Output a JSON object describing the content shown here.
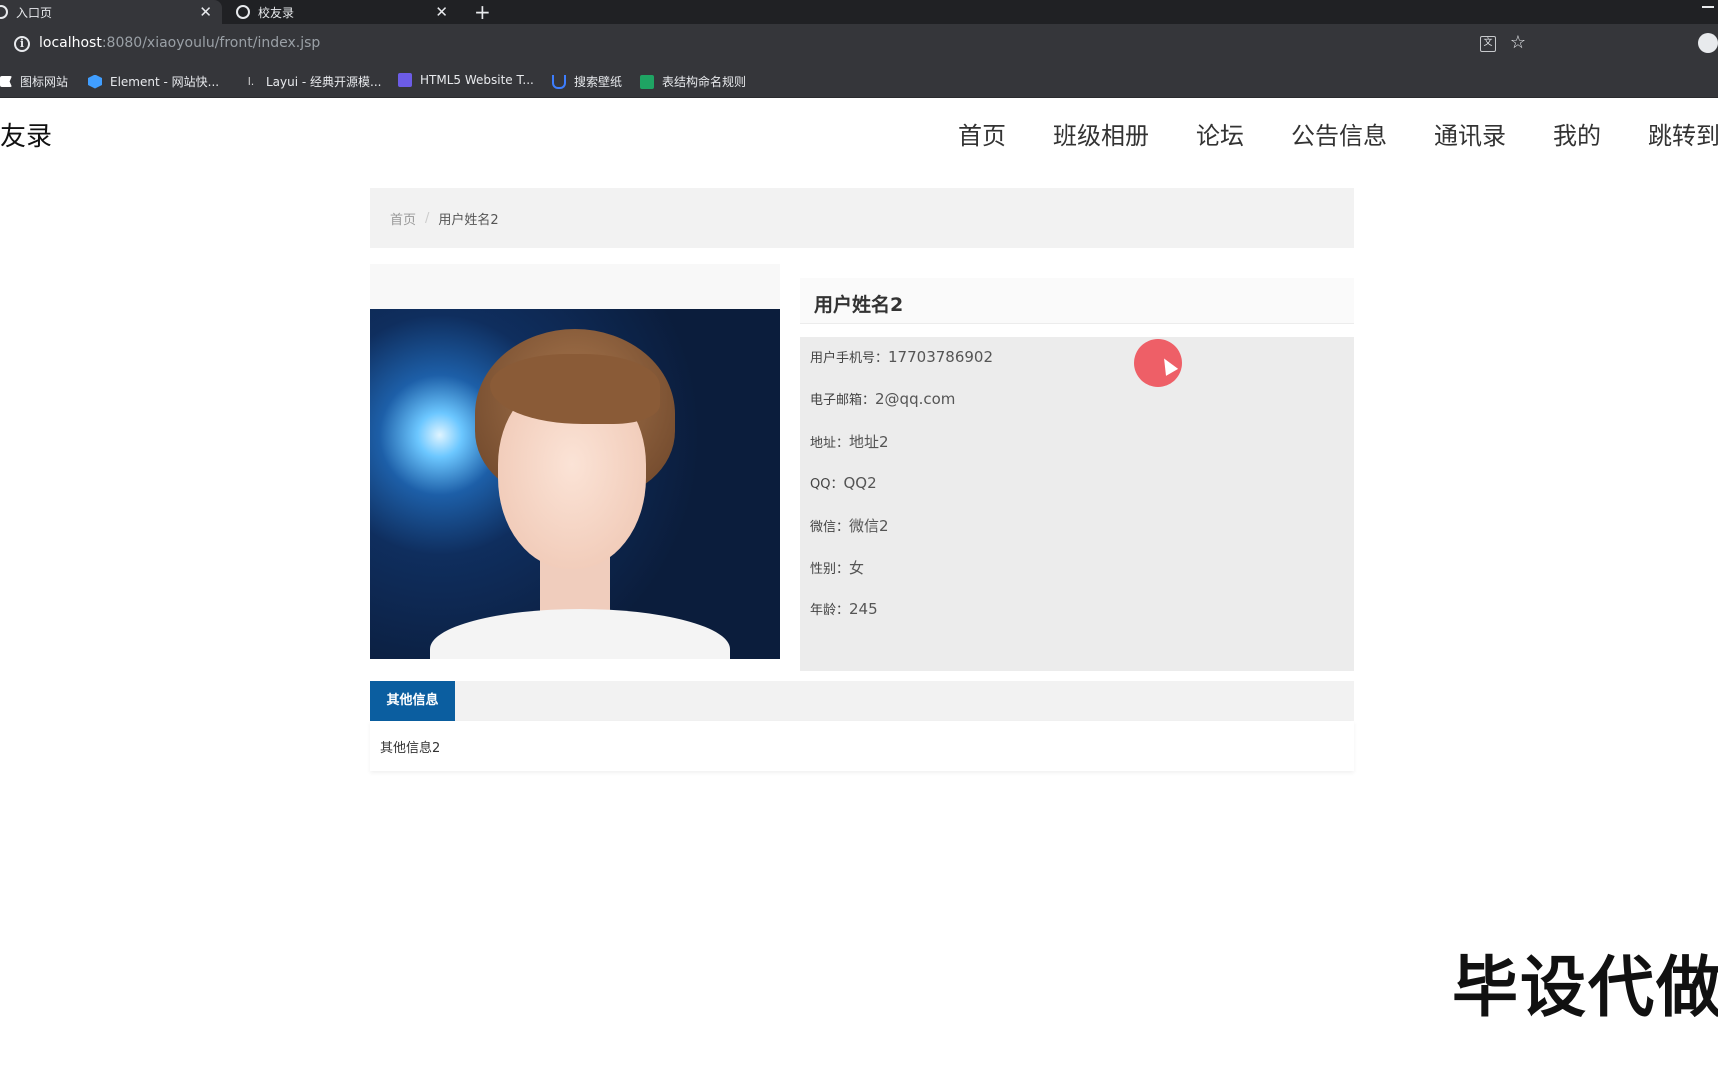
{
  "browser": {
    "tabs": [
      {
        "title": "入口页",
        "active": true
      },
      {
        "title": "校友录",
        "active": false
      }
    ],
    "new_tab": "+",
    "close_glyph": "✕",
    "url_host": "localhost",
    "url_path": ":8080/xiaoyoulu/front/index.jsp",
    "bookmarks": [
      {
        "label": "图标网站",
        "icon": "flag-icon",
        "color": "#ffffff"
      },
      {
        "label": "Element - 网站快...",
        "icon": "element-icon",
        "color": "#409eff"
      },
      {
        "label": "Layui - 经典开源模...",
        "icon": "layui-icon",
        "color": "#d7d7d7"
      },
      {
        "label": "HTML5 Website T...",
        "icon": "html5-icon",
        "color": "#6c5ce7"
      },
      {
        "label": "搜索壁纸",
        "icon": "wallpaper-icon",
        "color": "#3d7eff"
      },
      {
        "label": "表结构命名规则",
        "icon": "sheet-icon",
        "color": "#1fa463"
      }
    ]
  },
  "site": {
    "logo": "校友录",
    "nav": [
      "首页",
      "班级相册",
      "论坛",
      "公告信息",
      "通讯录",
      "我的",
      "跳转到后台"
    ]
  },
  "breadcrumb": {
    "home": "首页",
    "separator": "/",
    "current": "用户姓名2"
  },
  "detail": {
    "title": "用户姓名2",
    "fields": [
      {
        "label": "用户手机号：",
        "value": "17703786902"
      },
      {
        "label": "电子邮箱：",
        "value": "2@qq.com"
      },
      {
        "label": "地址：",
        "value": "地址2"
      },
      {
        "label": "QQ：",
        "value": "QQ2"
      },
      {
        "label": "微信：",
        "value": "微信2"
      },
      {
        "label": "性别：",
        "value": "女"
      },
      {
        "label": "年龄：",
        "value": "245"
      }
    ]
  },
  "extra": {
    "tab_label": "其他信息",
    "content": "其他信息2"
  },
  "watermark": "毕设代做",
  "colors": {
    "accent": "#0b5ea0",
    "cursor_highlight": "#ee4650"
  }
}
